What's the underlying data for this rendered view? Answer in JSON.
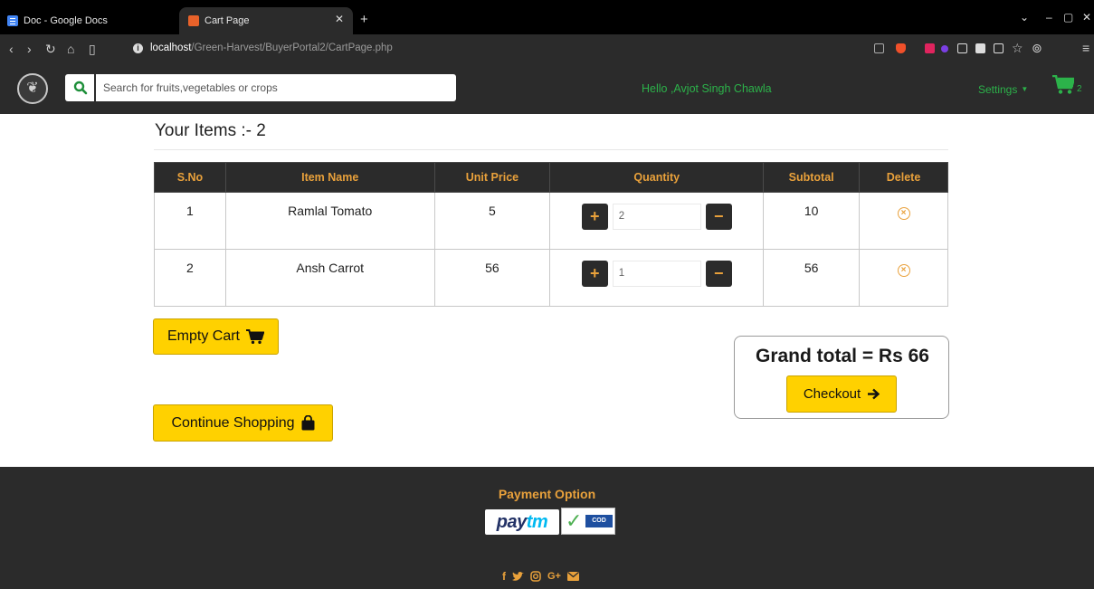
{
  "browser": {
    "tabs": [
      {
        "title": "Doc - Google Docs",
        "active": false
      },
      {
        "title": "Cart Page",
        "active": true
      }
    ],
    "url_host": "localhost",
    "url_path": "/Green-Harvest/BuyerPortal2/CartPage.php"
  },
  "navbar": {
    "search_placeholder": "Search for fruits,vegetables or crops",
    "greeting": "Hello ,Avjot Singh Chawla",
    "settings_label": "Settings",
    "cart_count": "2",
    "accent_color": "#2cb24a"
  },
  "cart": {
    "items_title": "Your Items :- 2",
    "columns": [
      "S.No",
      "Item Name",
      "Unit Price",
      "Quantity",
      "Subtotal",
      "Delete"
    ],
    "rows": [
      {
        "sno": "1",
        "name": "Ramlal Tomato",
        "unit_price": "5",
        "quantity": "2",
        "subtotal": "10"
      },
      {
        "sno": "2",
        "name": "Ansh Carrot",
        "unit_price": "56",
        "quantity": "1",
        "subtotal": "56"
      }
    ],
    "empty_cart_label": "Empty Cart",
    "continue_label": "Continue Shopping",
    "grand_total_label": "Grand total = Rs 66",
    "checkout_label": "Checkout"
  },
  "footer": {
    "payment_title": "Payment Option",
    "paytm_part1": "pay",
    "paytm_part2": "tm",
    "cod_label": "COD",
    "social_icons": [
      "facebook-icon",
      "twitter-icon",
      "instagram-icon",
      "google-plus-icon",
      "mail-icon"
    ]
  },
  "colors": {
    "button_yellow": "#ffd100",
    "header_orange": "#e9a13b",
    "dark_bg": "#2b2b2b"
  }
}
